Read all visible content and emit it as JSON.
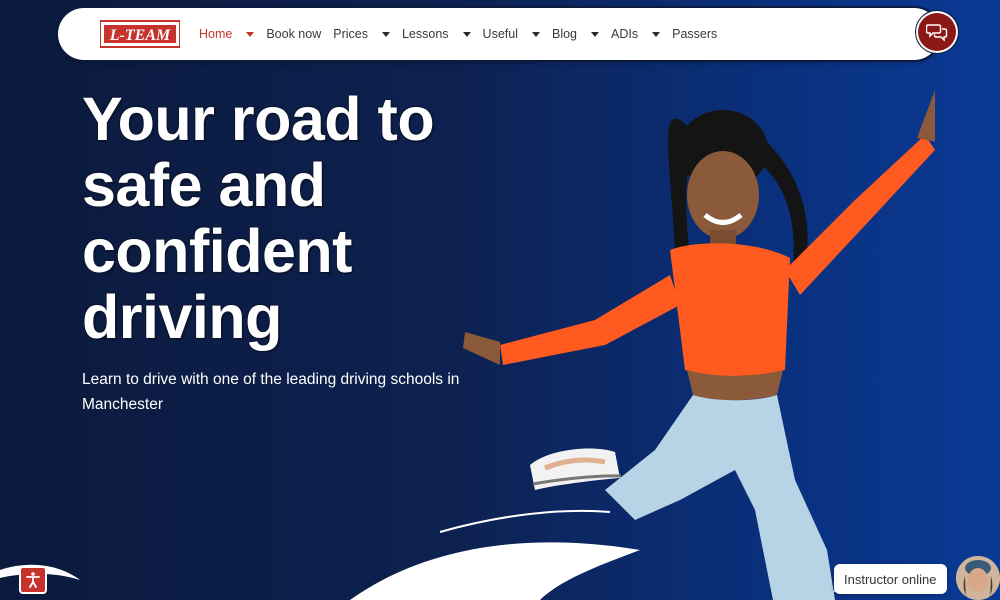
{
  "header": {
    "logo_text": "L-TEAM",
    "nav": [
      {
        "label": "Home",
        "dropdown": true,
        "active": true
      },
      {
        "label": "Book now",
        "dropdown": false
      },
      {
        "label": "Prices",
        "dropdown": true
      },
      {
        "label": "Lessons",
        "dropdown": true
      },
      {
        "label": "Useful",
        "dropdown": true
      },
      {
        "label": "Blog",
        "dropdown": true
      },
      {
        "label": "ADIs",
        "dropdown": true
      },
      {
        "label": "Passers",
        "dropdown": false
      }
    ]
  },
  "hero": {
    "title": "Your road to safe and confident driving",
    "subtitle": "Learn to drive with one of the leading driving schools in Manchester"
  },
  "widgets": {
    "instructor_label": "Instructor online"
  },
  "colors": {
    "brand_red": "#c6332c",
    "chat_red": "#8c1717",
    "navy": "#0b1a3d",
    "shirt_orange": "#ff5a1f",
    "jeans_blue": "#b7d3e6"
  },
  "icons": {
    "chat": "chat-bubbles-icon",
    "accessibility": "accessibility-icon",
    "caret": "chevron-down-icon"
  }
}
